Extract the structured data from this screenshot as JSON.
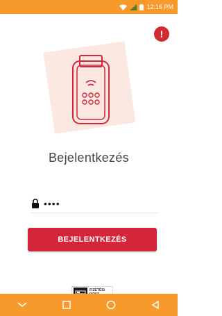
{
  "status_bar": {
    "time": "12:16 PM"
  },
  "login": {
    "title": "Bejelentkezés",
    "password_value": "••••",
    "button_label": "BEJELENTKEZÉS"
  },
  "logo": {
    "line1": "FIZETÉSI",
    "line2": "PONT"
  },
  "colors": {
    "accent": "#f79a2b",
    "primary_button": "#d4263a",
    "alert": "#d22a2f"
  },
  "icons": [
    "lock-icon",
    "alert-icon",
    "terminal-icon",
    "wifi-icon",
    "signal-icon",
    "battery-icon",
    "nav-back-icon",
    "nav-home-icon",
    "nav-recent-icon",
    "nav-down-icon"
  ]
}
